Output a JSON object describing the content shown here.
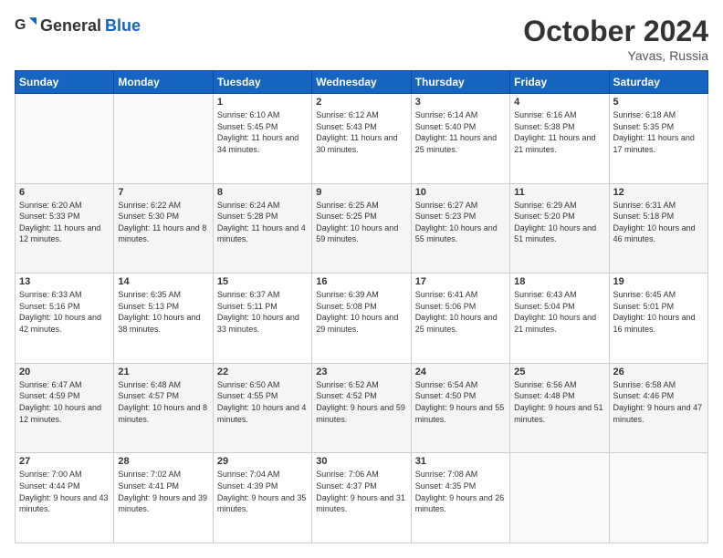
{
  "header": {
    "logo_general": "General",
    "logo_blue": "Blue",
    "title": "October 2024",
    "location": "Yavas, Russia"
  },
  "days_of_week": [
    "Sunday",
    "Monday",
    "Tuesday",
    "Wednesday",
    "Thursday",
    "Friday",
    "Saturday"
  ],
  "weeks": [
    [
      {
        "day": "",
        "sunrise": "",
        "sunset": "",
        "daylight": ""
      },
      {
        "day": "",
        "sunrise": "",
        "sunset": "",
        "daylight": ""
      },
      {
        "day": "1",
        "sunrise": "Sunrise: 6:10 AM",
        "sunset": "Sunset: 5:45 PM",
        "daylight": "Daylight: 11 hours and 34 minutes."
      },
      {
        "day": "2",
        "sunrise": "Sunrise: 6:12 AM",
        "sunset": "Sunset: 5:43 PM",
        "daylight": "Daylight: 11 hours and 30 minutes."
      },
      {
        "day": "3",
        "sunrise": "Sunrise: 6:14 AM",
        "sunset": "Sunset: 5:40 PM",
        "daylight": "Daylight: 11 hours and 25 minutes."
      },
      {
        "day": "4",
        "sunrise": "Sunrise: 6:16 AM",
        "sunset": "Sunset: 5:38 PM",
        "daylight": "Daylight: 11 hours and 21 minutes."
      },
      {
        "day": "5",
        "sunrise": "Sunrise: 6:18 AM",
        "sunset": "Sunset: 5:35 PM",
        "daylight": "Daylight: 11 hours and 17 minutes."
      }
    ],
    [
      {
        "day": "6",
        "sunrise": "Sunrise: 6:20 AM",
        "sunset": "Sunset: 5:33 PM",
        "daylight": "Daylight: 11 hours and 12 minutes."
      },
      {
        "day": "7",
        "sunrise": "Sunrise: 6:22 AM",
        "sunset": "Sunset: 5:30 PM",
        "daylight": "Daylight: 11 hours and 8 minutes."
      },
      {
        "day": "8",
        "sunrise": "Sunrise: 6:24 AM",
        "sunset": "Sunset: 5:28 PM",
        "daylight": "Daylight: 11 hours and 4 minutes."
      },
      {
        "day": "9",
        "sunrise": "Sunrise: 6:25 AM",
        "sunset": "Sunset: 5:25 PM",
        "daylight": "Daylight: 10 hours and 59 minutes."
      },
      {
        "day": "10",
        "sunrise": "Sunrise: 6:27 AM",
        "sunset": "Sunset: 5:23 PM",
        "daylight": "Daylight: 10 hours and 55 minutes."
      },
      {
        "day": "11",
        "sunrise": "Sunrise: 6:29 AM",
        "sunset": "Sunset: 5:20 PM",
        "daylight": "Daylight: 10 hours and 51 minutes."
      },
      {
        "day": "12",
        "sunrise": "Sunrise: 6:31 AM",
        "sunset": "Sunset: 5:18 PM",
        "daylight": "Daylight: 10 hours and 46 minutes."
      }
    ],
    [
      {
        "day": "13",
        "sunrise": "Sunrise: 6:33 AM",
        "sunset": "Sunset: 5:16 PM",
        "daylight": "Daylight: 10 hours and 42 minutes."
      },
      {
        "day": "14",
        "sunrise": "Sunrise: 6:35 AM",
        "sunset": "Sunset: 5:13 PM",
        "daylight": "Daylight: 10 hours and 38 minutes."
      },
      {
        "day": "15",
        "sunrise": "Sunrise: 6:37 AM",
        "sunset": "Sunset: 5:11 PM",
        "daylight": "Daylight: 10 hours and 33 minutes."
      },
      {
        "day": "16",
        "sunrise": "Sunrise: 6:39 AM",
        "sunset": "Sunset: 5:08 PM",
        "daylight": "Daylight: 10 hours and 29 minutes."
      },
      {
        "day": "17",
        "sunrise": "Sunrise: 6:41 AM",
        "sunset": "Sunset: 5:06 PM",
        "daylight": "Daylight: 10 hours and 25 minutes."
      },
      {
        "day": "18",
        "sunrise": "Sunrise: 6:43 AM",
        "sunset": "Sunset: 5:04 PM",
        "daylight": "Daylight: 10 hours and 21 minutes."
      },
      {
        "day": "19",
        "sunrise": "Sunrise: 6:45 AM",
        "sunset": "Sunset: 5:01 PM",
        "daylight": "Daylight: 10 hours and 16 minutes."
      }
    ],
    [
      {
        "day": "20",
        "sunrise": "Sunrise: 6:47 AM",
        "sunset": "Sunset: 4:59 PM",
        "daylight": "Daylight: 10 hours and 12 minutes."
      },
      {
        "day": "21",
        "sunrise": "Sunrise: 6:48 AM",
        "sunset": "Sunset: 4:57 PM",
        "daylight": "Daylight: 10 hours and 8 minutes."
      },
      {
        "day": "22",
        "sunrise": "Sunrise: 6:50 AM",
        "sunset": "Sunset: 4:55 PM",
        "daylight": "Daylight: 10 hours and 4 minutes."
      },
      {
        "day": "23",
        "sunrise": "Sunrise: 6:52 AM",
        "sunset": "Sunset: 4:52 PM",
        "daylight": "Daylight: 9 hours and 59 minutes."
      },
      {
        "day": "24",
        "sunrise": "Sunrise: 6:54 AM",
        "sunset": "Sunset: 4:50 PM",
        "daylight": "Daylight: 9 hours and 55 minutes."
      },
      {
        "day": "25",
        "sunrise": "Sunrise: 6:56 AM",
        "sunset": "Sunset: 4:48 PM",
        "daylight": "Daylight: 9 hours and 51 minutes."
      },
      {
        "day": "26",
        "sunrise": "Sunrise: 6:58 AM",
        "sunset": "Sunset: 4:46 PM",
        "daylight": "Daylight: 9 hours and 47 minutes."
      }
    ],
    [
      {
        "day": "27",
        "sunrise": "Sunrise: 7:00 AM",
        "sunset": "Sunset: 4:44 PM",
        "daylight": "Daylight: 9 hours and 43 minutes."
      },
      {
        "day": "28",
        "sunrise": "Sunrise: 7:02 AM",
        "sunset": "Sunset: 4:41 PM",
        "daylight": "Daylight: 9 hours and 39 minutes."
      },
      {
        "day": "29",
        "sunrise": "Sunrise: 7:04 AM",
        "sunset": "Sunset: 4:39 PM",
        "daylight": "Daylight: 9 hours and 35 minutes."
      },
      {
        "day": "30",
        "sunrise": "Sunrise: 7:06 AM",
        "sunset": "Sunset: 4:37 PM",
        "daylight": "Daylight: 9 hours and 31 minutes."
      },
      {
        "day": "31",
        "sunrise": "Sunrise: 7:08 AM",
        "sunset": "Sunset: 4:35 PM",
        "daylight": "Daylight: 9 hours and 26 minutes."
      },
      {
        "day": "",
        "sunrise": "",
        "sunset": "",
        "daylight": ""
      },
      {
        "day": "",
        "sunrise": "",
        "sunset": "",
        "daylight": ""
      }
    ]
  ]
}
